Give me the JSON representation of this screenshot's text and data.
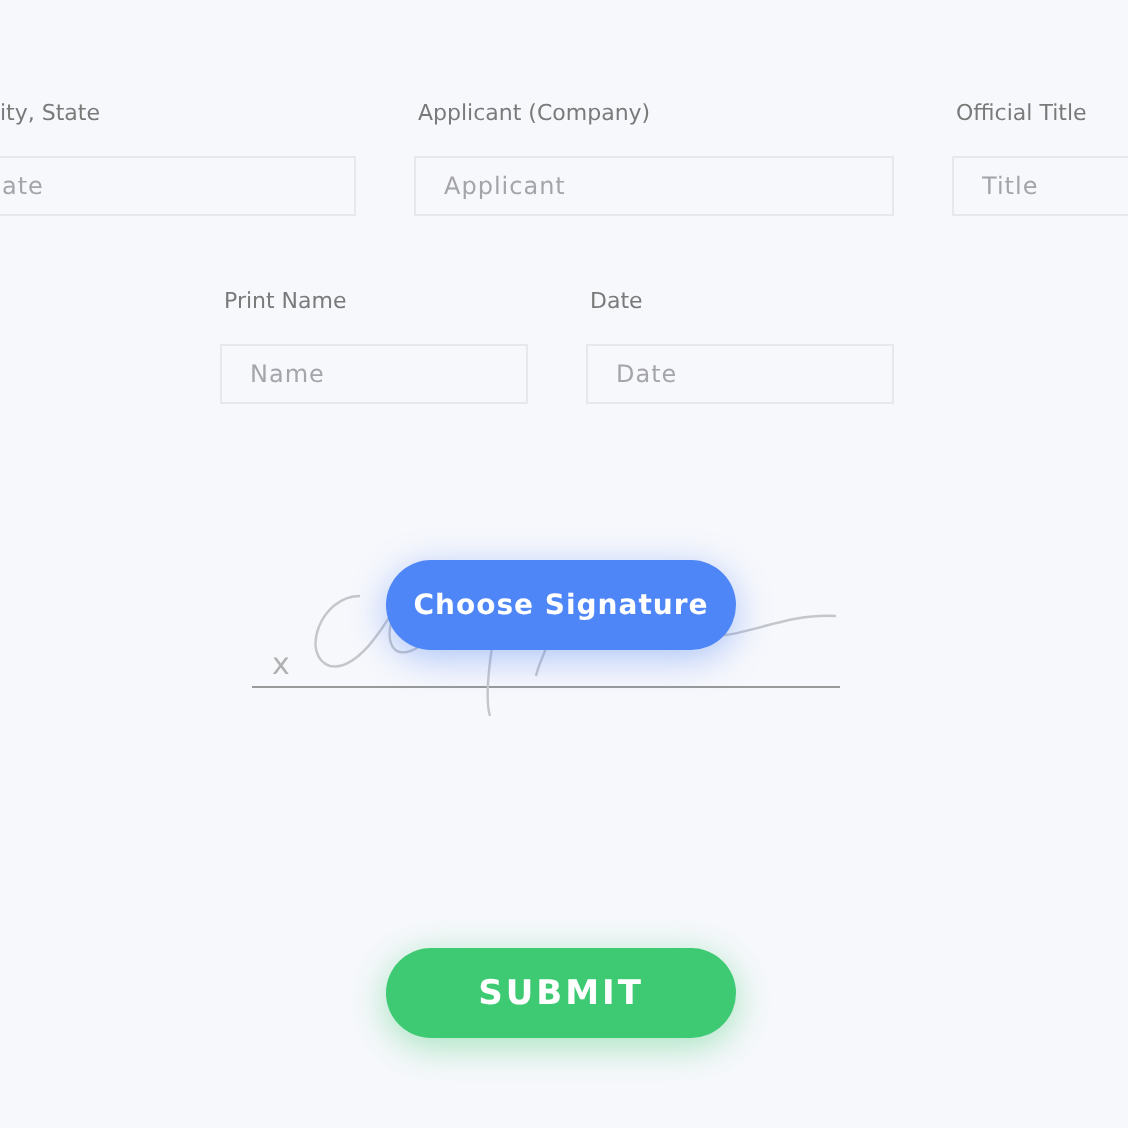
{
  "field_rows": [
    [
      {
        "label": "ity, State",
        "placeholder": "ate"
      },
      {
        "label": "Applicant (Company)",
        "placeholder": "Applicant"
      },
      {
        "label": "Official Title",
        "placeholder": "Title"
      }
    ],
    [
      {
        "label": "Print Name",
        "placeholder": "Name"
      },
      {
        "label": "Date",
        "placeholder": "Date"
      }
    ]
  ],
  "signature": {
    "mark": "x",
    "button": "Choose Signature"
  },
  "submit": "SUBMIT"
}
